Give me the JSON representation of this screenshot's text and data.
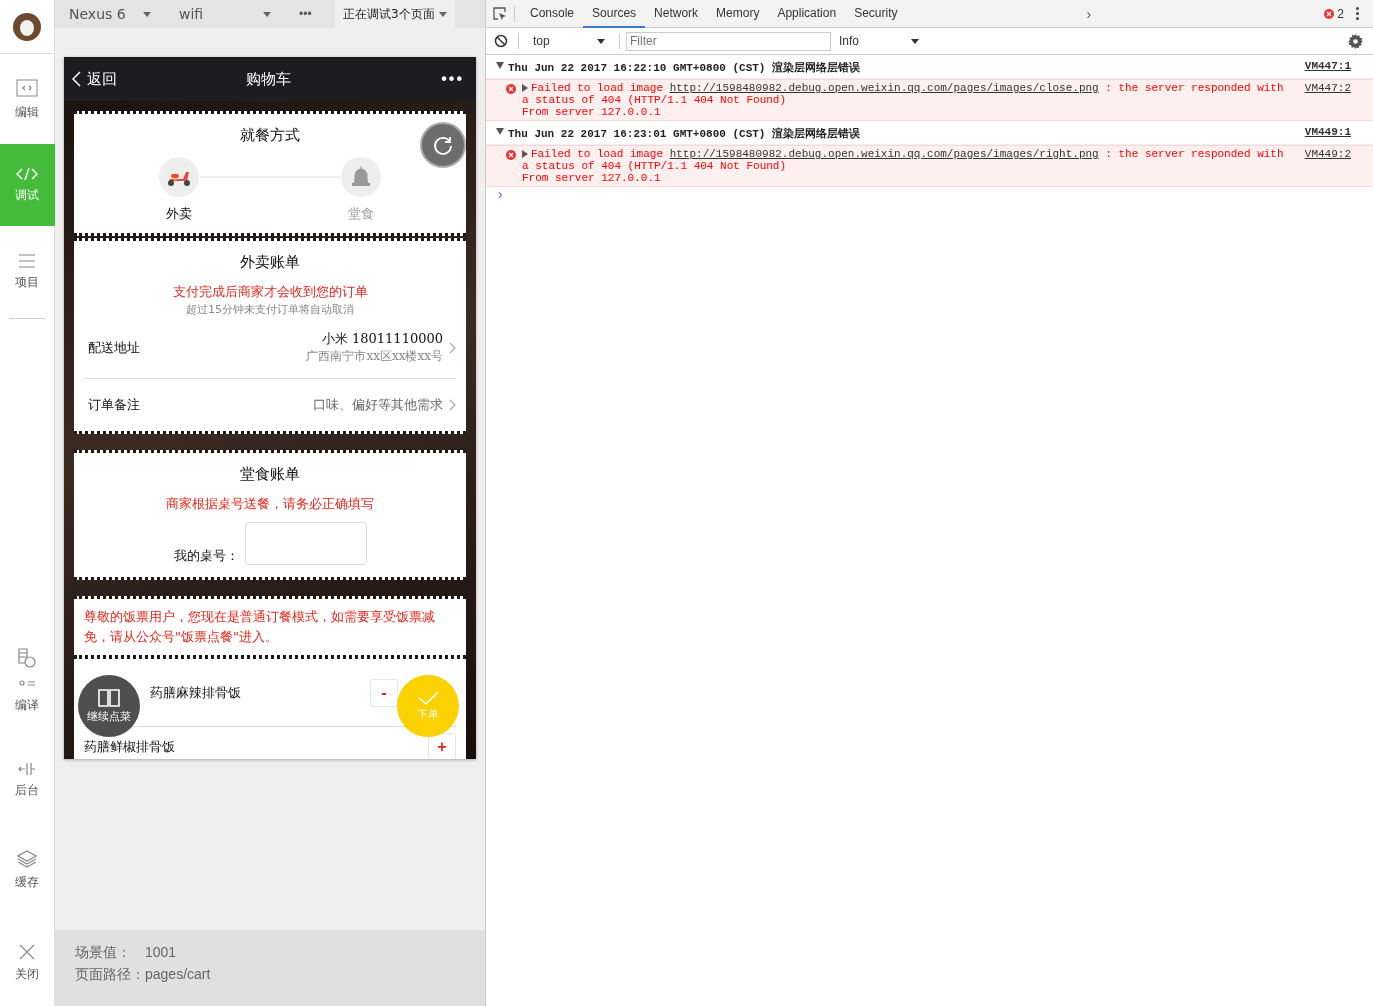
{
  "sidebar": {
    "avatar": {
      "kind": "avatar"
    },
    "items": [
      {
        "kind": "editor",
        "label": "编辑",
        "selected": false
      },
      {
        "kind": "debug",
        "label": "调试",
        "selected": true
      },
      {
        "kind": "project",
        "label": "项目",
        "selected": false
      },
      {
        "kind": "compile",
        "label": "编译",
        "selected": false
      },
      {
        "kind": "backend",
        "label": "后台",
        "selected": false
      },
      {
        "kind": "cache",
        "label": "缓存",
        "selected": false
      },
      {
        "kind": "close",
        "label": "关闭",
        "selected": false
      }
    ]
  },
  "simulator_toolbar": {
    "device": "Nexus 6",
    "network": "wifi",
    "more": "•••",
    "debug_pages": "正在调试3个页面"
  },
  "phone": {
    "nav": {
      "back": "返回",
      "title": "购物车",
      "more": "•••"
    },
    "dining": {
      "title": "就餐方式",
      "options": [
        {
          "kind": "scooter",
          "label": "外卖",
          "selected": true
        },
        {
          "kind": "bell",
          "label": "堂食",
          "selected": false
        }
      ]
    },
    "takeout": {
      "title": "外卖账单",
      "notice": "支付完成后商家才会收到您的订单",
      "subnotice": "超过15分钟未支付订单将自动取消",
      "rows": [
        {
          "label": "配送地址",
          "value": "小米 18011110000",
          "detail": "广西南宁市xx区xx楼xx号"
        },
        {
          "label": "订单备注",
          "value": "口味、偏好等其他需求"
        }
      ]
    },
    "dine_in": {
      "title": "堂食账单",
      "notice": "商家根据桌号送餐，请务必正确填写",
      "table_label": "我的桌号："
    },
    "voucher_notice": "尊敬的饭票用户，您现在是普通订餐模式，如需要享受饭票减免，请从公众号\"饭票点餐\"进入。",
    "items": [
      {
        "name": "药膳麻辣排骨饭",
        "minus": "-"
      },
      {
        "name": "药膳鲜椒排骨饭",
        "plus": "+"
      }
    ],
    "continue_button": "继续点菜",
    "order_button": "下单"
  },
  "info": {
    "scene_label": "场景值：",
    "scene": "1001",
    "path_label": "页面路径：",
    "path": "pages/cart"
  },
  "devtools": {
    "tabs": [
      {
        "label": "Console",
        "selected": false
      },
      {
        "label": "Sources",
        "selected": true
      },
      {
        "label": "Network",
        "selected": false
      },
      {
        "label": "Memory",
        "selected": false
      },
      {
        "label": "Application",
        "selected": false
      },
      {
        "label": "Security",
        "selected": false
      }
    ],
    "overflow": "›",
    "error_count": "2",
    "toolbar": {
      "context": "top",
      "filter_placeholder": "Filter",
      "level": "Info"
    },
    "groups": [
      {
        "header": "Thu Jun 22 2017 16:22:10 GMT+0800 (CST) 渲染层网络层错误",
        "source": "VM447:1",
        "entries": [
          {
            "prefix": "Failed to load image ",
            "url": "http://1598480982.debug.open.weixin.qq.com/pages/images/close.png",
            "suffix": " : the server responded with",
            "lines": [
              "a status of 404 (HTTP/1.1 404 Not Found)",
              "From server 127.0.0.1"
            ],
            "source": "VM447:2"
          }
        ]
      },
      {
        "header": "Thu Jun 22 2017 16:23:01 GMT+0800 (CST) 渲染层网络层错误",
        "source": "VM449:1",
        "entries": [
          {
            "prefix": "Failed to load image ",
            "url": "http://1598480982.debug.open.weixin.qq.com/pages/images/right.png",
            "suffix": " : the server responded with",
            "lines": [
              "a status of 404 (HTTP/1.1 404 Not Found)",
              "From server 127.0.0.1"
            ],
            "source": "VM449:2"
          }
        ]
      }
    ],
    "prompt": "›"
  }
}
